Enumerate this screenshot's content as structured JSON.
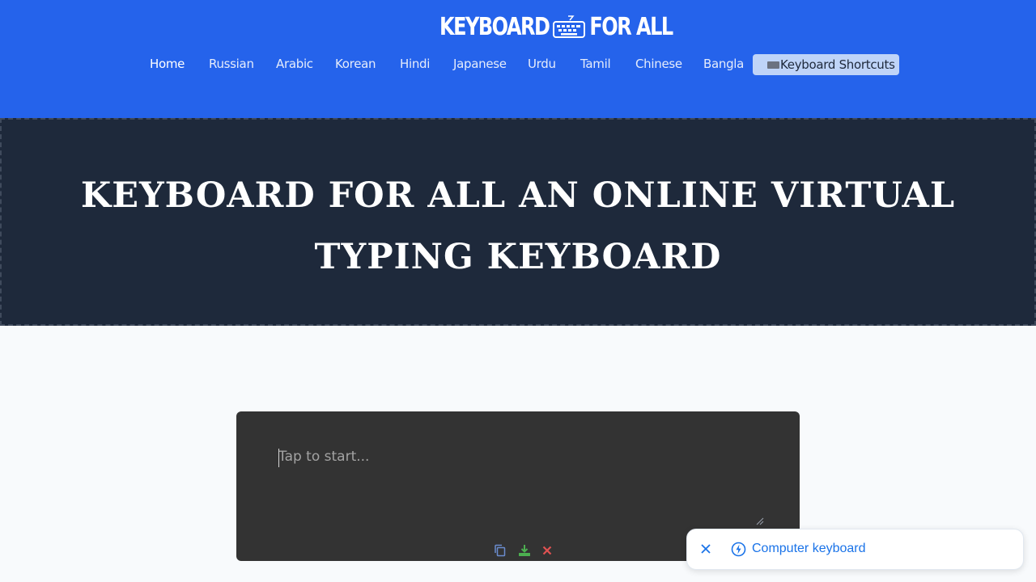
{
  "brand": {
    "logo_part1": "KEYBOARD",
    "logo_part2": "FOR ALL",
    "header_color": "#2563eb"
  },
  "nav": {
    "items": [
      {
        "label": "Home",
        "active": true
      },
      {
        "label": "Russian"
      },
      {
        "label": "Arabic"
      },
      {
        "label": "Korean"
      },
      {
        "label": "Hindi"
      },
      {
        "label": "Japanese"
      },
      {
        "label": "Urdu"
      },
      {
        "label": "Tamil"
      },
      {
        "label": "Chinese"
      },
      {
        "label": "Bangla"
      }
    ],
    "shortcuts_label": "Keyboard Shortcuts",
    "shortcuts_icon": "keyboard-emoji"
  },
  "hero": {
    "line1": "KEYBOARD FOR ALL AN ONLINE VIRTUAL",
    "line2": "TYPING KEYBOARD",
    "background": "#1e293b"
  },
  "editor": {
    "placeholder": "Tap to start...",
    "value": "",
    "tools": [
      {
        "name": "copy-icon",
        "color": "#6b8cce"
      },
      {
        "name": "download-icon",
        "color": "#4caf50"
      },
      {
        "name": "clear-icon",
        "color": "#e05252"
      }
    ]
  },
  "toast": {
    "label": "Computer keyboard",
    "icons": [
      "close-icon",
      "bolt-icon"
    ],
    "accent": "#1a73e8"
  }
}
